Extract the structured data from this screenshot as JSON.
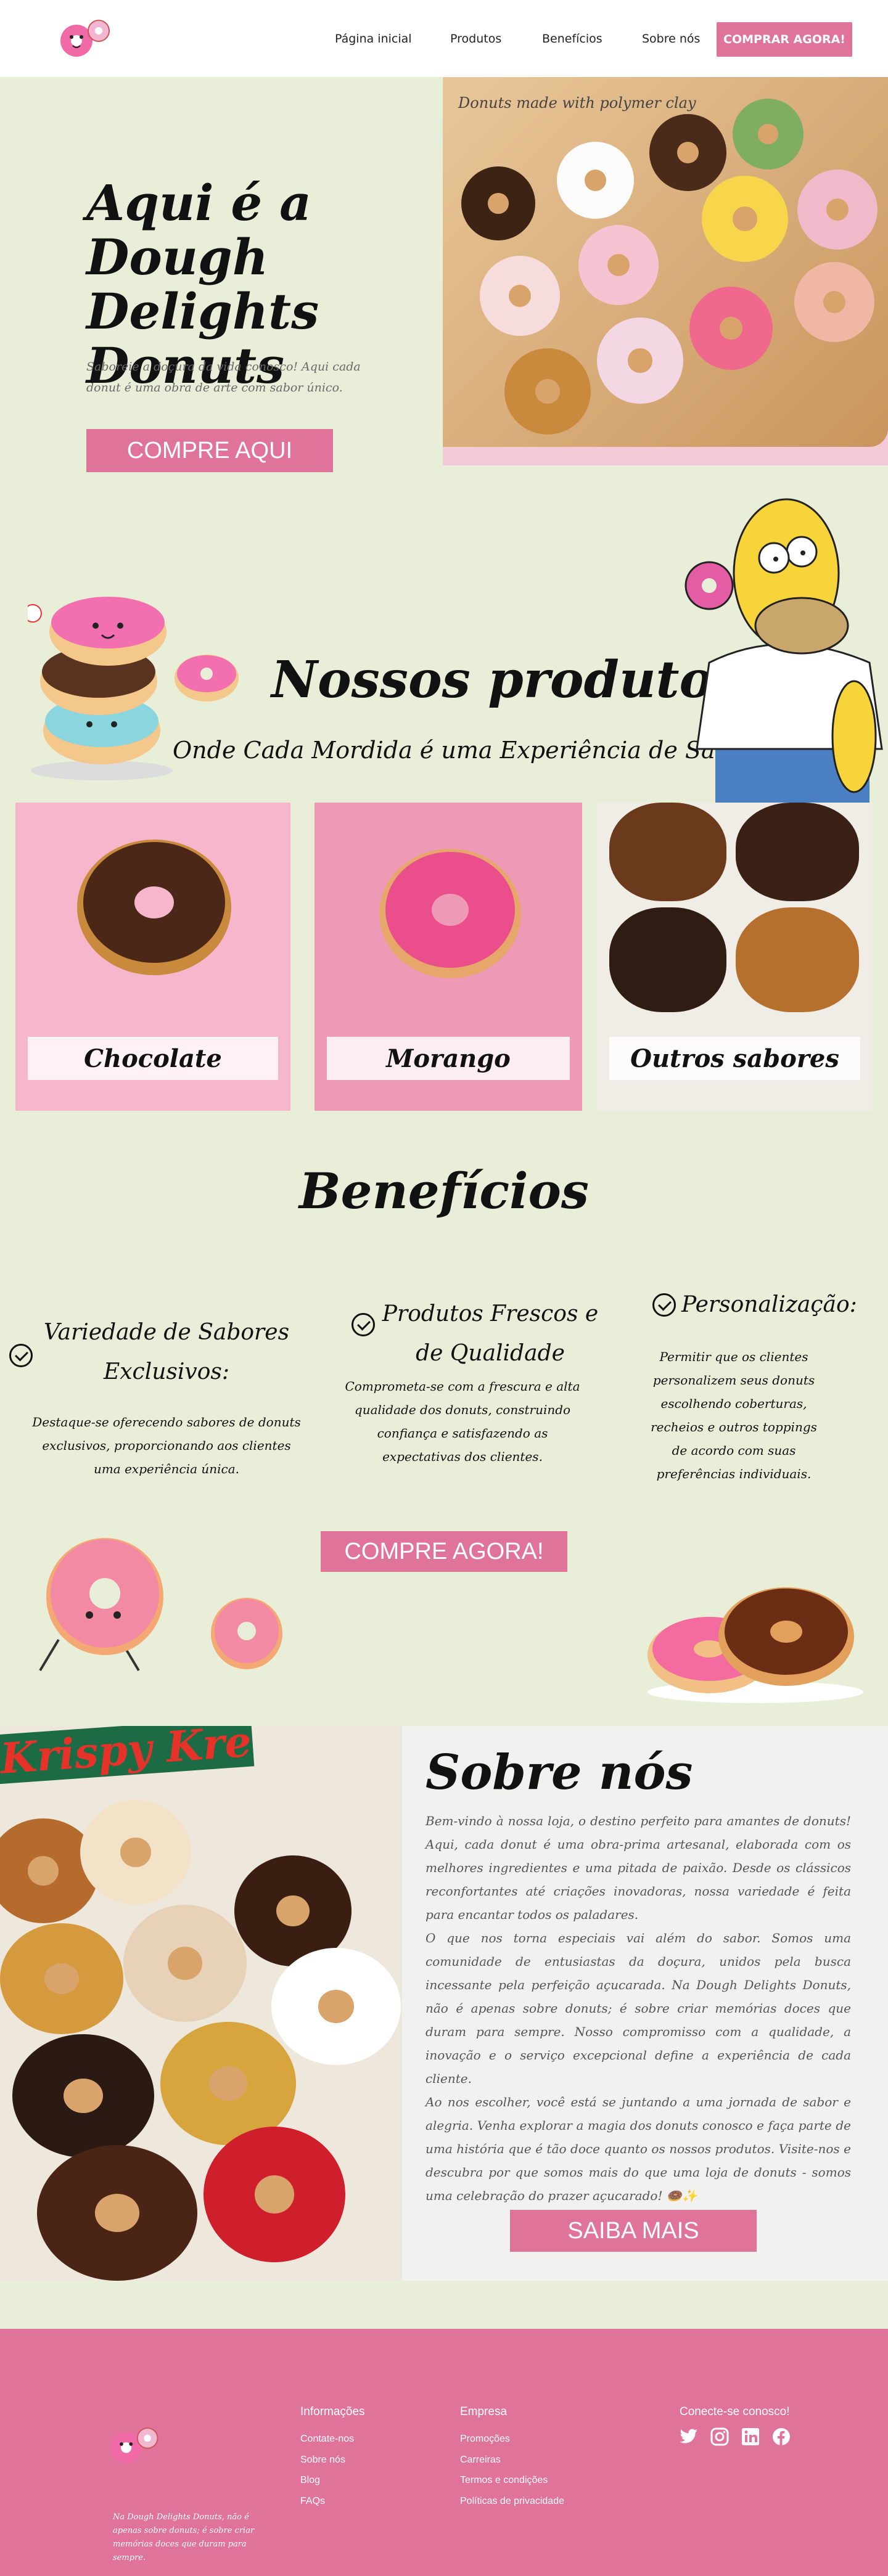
{
  "header": {
    "nav": [
      "Página inicial",
      "Produtos",
      "Benefícios",
      "Sobre nós"
    ],
    "cta": "COMPRAR AGORA!"
  },
  "hero": {
    "title": "Aqui é a Dough Delights Donuts",
    "subtitle": "Saboreie a doçura da vida conosco! Aqui cada donut é uma obra de arte com sabor único.",
    "button": "COMPRE AQUI",
    "image_caption": "Donuts made with polymer clay"
  },
  "products": {
    "title": "Nossos produtos",
    "subtitle": "Onde Cada Mordida é uma Experiência de Sabor! 🍩",
    "cards": [
      {
        "label": "Chocolate"
      },
      {
        "label": "Morango"
      },
      {
        "label": "Outros sabores"
      }
    ]
  },
  "benefits": {
    "title": "Benefícios",
    "items": [
      {
        "heading": "Variedade de Sabores Exclusivos:",
        "text": "Destaque-se oferecendo sabores de donuts exclusivos, proporcionando aos clientes uma experiência única."
      },
      {
        "heading": "Produtos Frescos e de Qualidade",
        "text": "Comprometa-se com a frescura e alta qualidade dos donuts, construindo confiança e satisfazendo as expectativas dos clientes."
      },
      {
        "heading": "Personalização:",
        "text": "Permitir que os clientes personalizem seus donuts escolhendo coberturas, recheios e outros toppings de acordo com suas preferências individuais."
      }
    ],
    "button": "COMPRE AGORA!"
  },
  "about": {
    "title": "Sobre nós",
    "paragraphs": [
      "Bem-vindo à nossa loja, o destino perfeito para amantes de donuts! Aqui, cada donut é uma obra-prima artesanal, elaborada com os melhores ingredientes e uma pitada de paixão. Desde os clássicos reconfortantes até criações inovadoras, nossa variedade é feita para encantar todos os paladares.",
      "O que nos torna especiais vai além do sabor. Somos uma comunidade de entusiastas da doçura, unidos pela busca incessante pela perfeição açucarada. Na Dough Delights Donuts, não é apenas sobre donuts; é sobre criar memórias doces que duram para sempre. Nosso compromisso com a qualidade, a inovação e o serviço excepcional define a experiência de cada cliente.",
      "Ao nos escolher, você está se juntando a uma jornada de sabor e alegria. Venha explorar a magia dos donuts conosco e faça parte de uma história que é tão doce quanto os nossos produtos. Visite-nos e descubra por que somos mais do que uma loja de donuts - somos uma celebração do prazer açucarado! 🍩✨"
    ],
    "button": "SAIBA MAIS",
    "image_text": "Krispy Kreme"
  },
  "footer": {
    "description": "Na Dough Delights Donuts, não é apenas sobre donuts; é sobre criar memórias doces que duram para sempre.",
    "col1": {
      "title": "Informações",
      "links": [
        "Contate-nos",
        "Sobre nós",
        "Blog",
        "FAQs"
      ]
    },
    "col2": {
      "title": "Empresa",
      "links": [
        "Promoções",
        "Carreiras",
        "Termos e condições",
        "Políticas de privacidade"
      ]
    },
    "col3": {
      "title": "Conecte-se conosco!"
    },
    "social_icons": [
      "twitter-icon",
      "instagram-icon",
      "linkedin-icon",
      "facebook-icon"
    ]
  },
  "colors": {
    "accent": "#e07399",
    "background": "#e8eed8",
    "about_bg": "#f1f1ef"
  }
}
